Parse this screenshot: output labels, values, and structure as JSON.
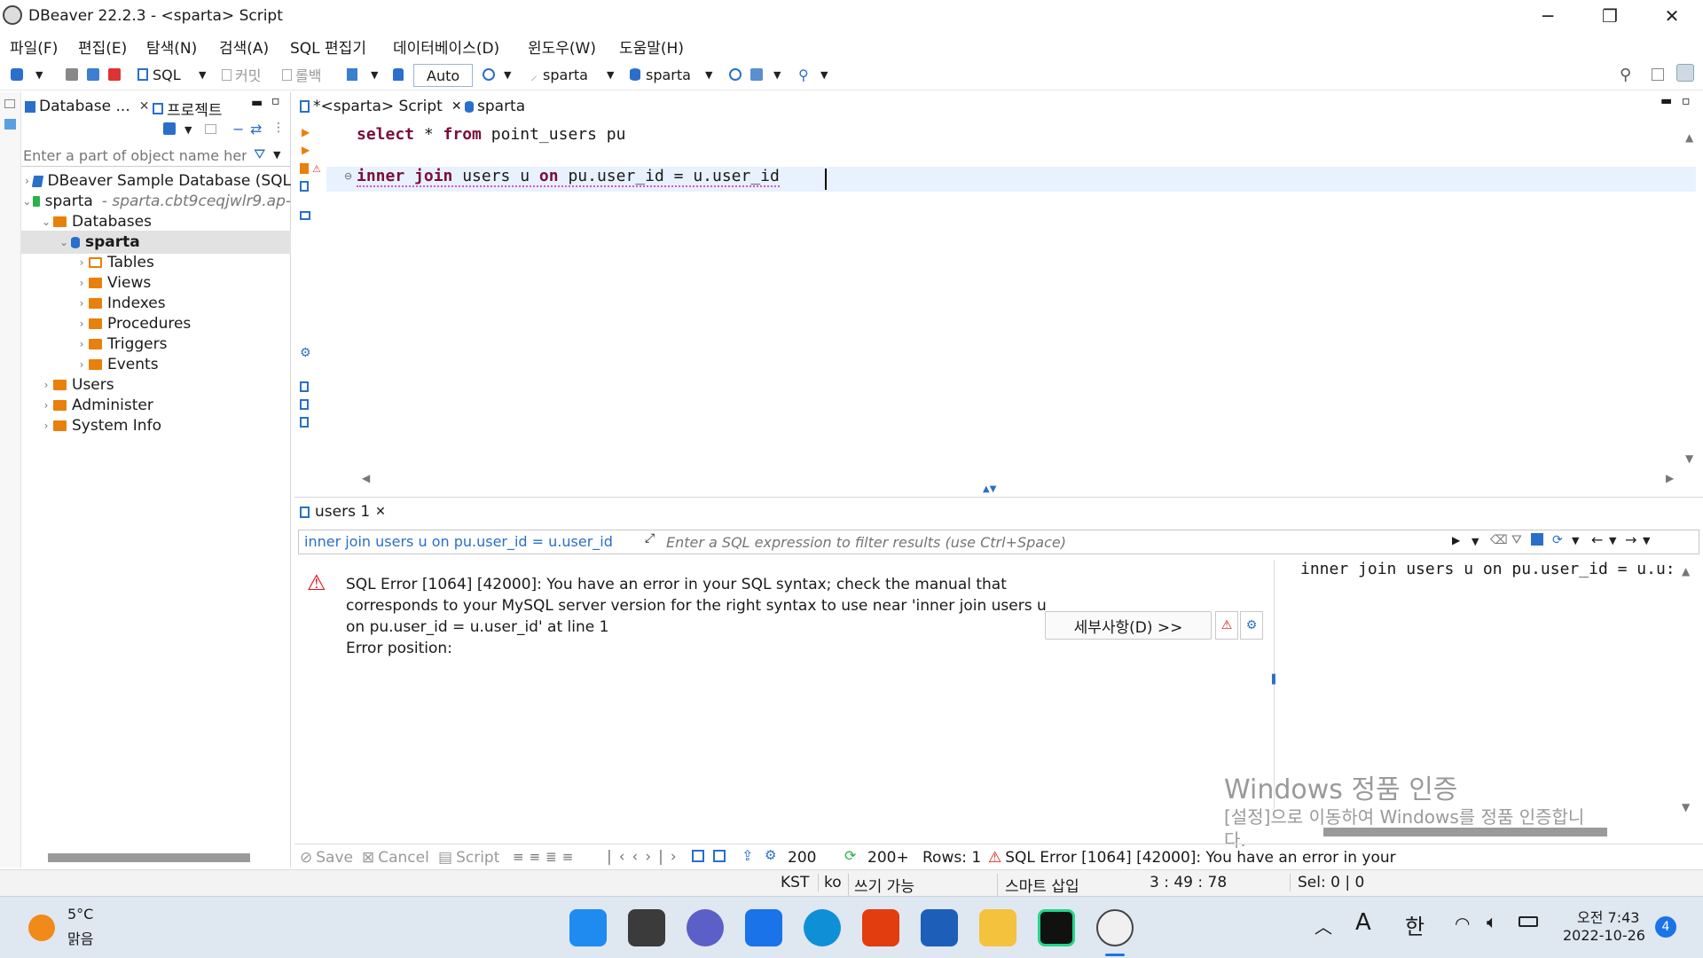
{
  "window": {
    "title": "DBeaver 22.2.3 - <sparta> Script"
  },
  "menu": [
    "파일(F)",
    "편집(E)",
    "탐색(N)",
    "검색(A)",
    "SQL 편집기",
    "데이터베이스(D)",
    "윈도우(W)",
    "도움말(H)"
  ],
  "toolbar": {
    "sql": "SQL",
    "commit": "커밋",
    "rollback": "롤백",
    "mode": "Auto",
    "datasource": "sparta",
    "schema": "sparta"
  },
  "navigator": {
    "tab_database": "Database ...",
    "tab_project": "프로젝트",
    "filter_placeholder": "Enter a part of object name here",
    "tree": [
      {
        "label": "DBeaver Sample Database (SQL",
        "level": 0
      },
      {
        "label": "sparta",
        "sub": "- sparta.cbt9ceqjwlr9.ap-",
        "level": 0
      },
      {
        "label": "Databases",
        "level": 1
      },
      {
        "label": "sparta",
        "level": 2
      },
      {
        "label": "Tables",
        "level": 3
      },
      {
        "label": "Views",
        "level": 3
      },
      {
        "label": "Indexes",
        "level": 3
      },
      {
        "label": "Procedures",
        "level": 3
      },
      {
        "label": "Triggers",
        "level": 3
      },
      {
        "label": "Events",
        "level": 3
      },
      {
        "label": "Users",
        "level": 1
      },
      {
        "label": "Administer",
        "level": 1
      },
      {
        "label": "System Info",
        "level": 1
      }
    ]
  },
  "editor": {
    "tab_script": "*<sparta> Script",
    "tab_sparta": "sparta",
    "line1": {
      "k1": "select",
      "t1": " * ",
      "k2": "from",
      "t2": " point_users pu"
    },
    "line2": {
      "k1": "inner join",
      "t1": " users u ",
      "k2": "on",
      "t2": " pu.user_id = u.user_id"
    }
  },
  "results": {
    "tab": "users 1",
    "query_text": "inner join users u on pu.user_id = u.user_id",
    "filter_placeholder": "Enter a SQL expression to filter results (use Ctrl+Space)",
    "error_line1": "SQL Error [1064] [42000]: You have an error in your SQL syntax; check the manual that",
    "error_line2": "corresponds to your MySQL server version for the right syntax to use near 'inner join users u",
    "error_line3": "on pu.user_id = u.user_id' at line 1",
    "error_line4": "Error position:",
    "details_button": "세부사항(D) >>",
    "side_query": "inner join users u on pu.user_id = u.u:",
    "watermark1": "Windows 정품 인증",
    "watermark2": "[설정]으로 이동하여 Windows를 정품 인증합니",
    "watermark3": "다.",
    "bottom": {
      "save": "Save",
      "cancel": "Cancel",
      "script": "Script",
      "fetch_size": "200",
      "fetched": "200+",
      "rows": "Rows: 1",
      "error": "SQL Error [1064] [42000]: You have an error in your"
    }
  },
  "status": {
    "tz": "KST",
    "lang": "ko",
    "writable": "쓰기 가능",
    "insert": "스마트 삽입",
    "pos": "3 : 49 : 78",
    "sel": "Sel: 0 | 0"
  },
  "taskbar": {
    "temp": "5°C",
    "weather": "맑음",
    "time": "오전 7:43",
    "date": "2022-10-26",
    "notif": "4",
    "ime1": "A",
    "ime2": "한"
  },
  "colors": {
    "keyword": "#7b0d3a",
    "selection": "#e2e2e2",
    "folder": "#e8800c",
    "accent": "#0a64c8"
  }
}
